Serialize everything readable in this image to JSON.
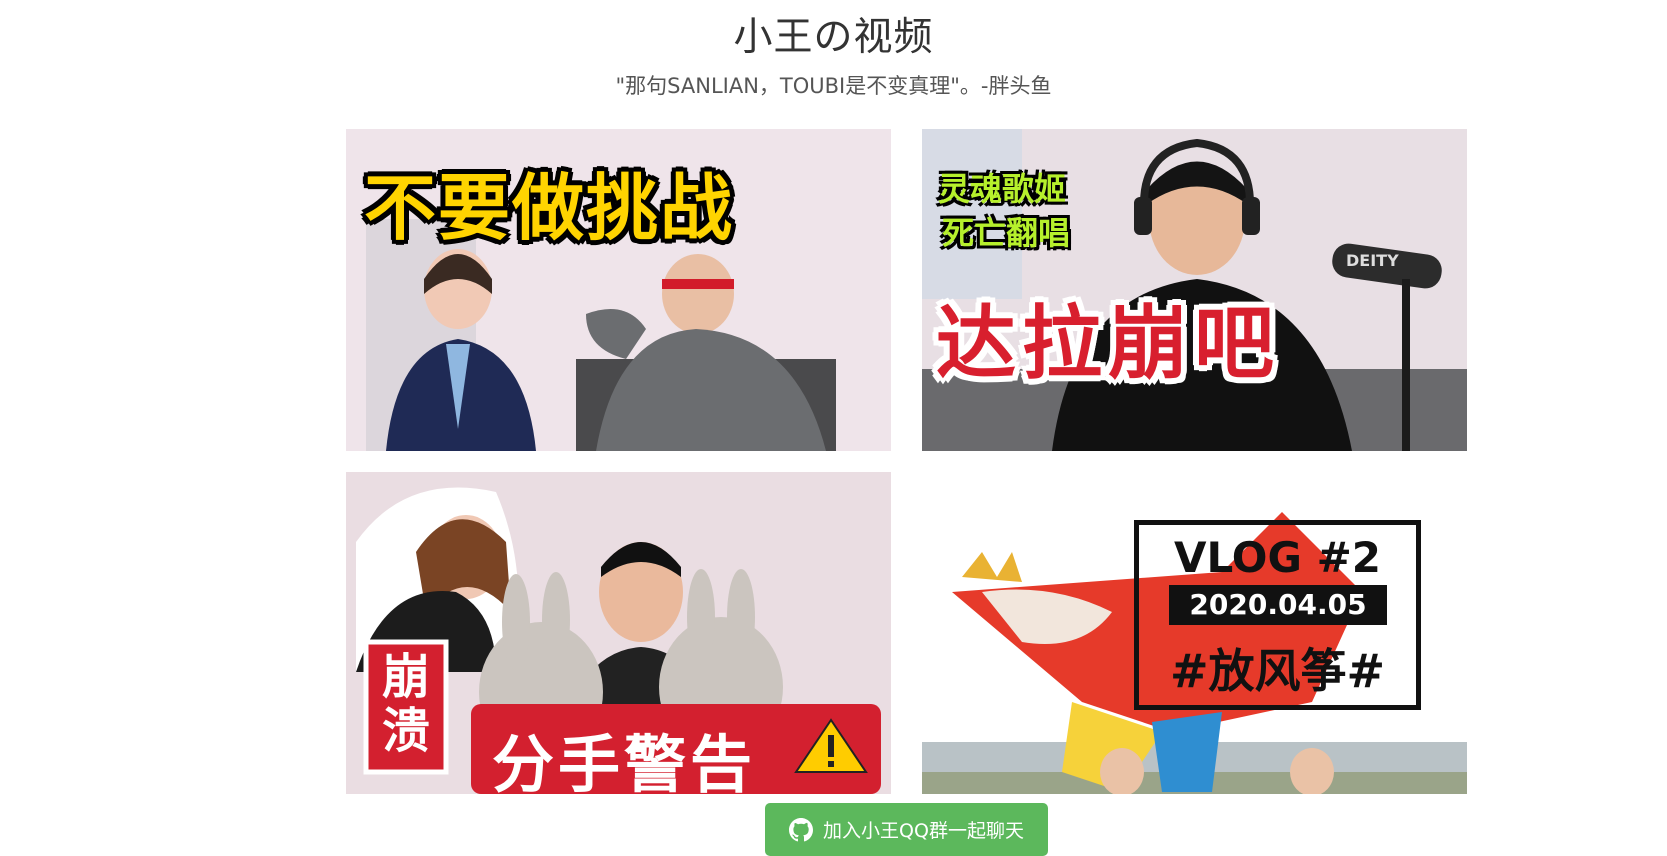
{
  "page": {
    "title": "小王の视频",
    "subtitle": "\"那句SANLIAN，TOUBI是不变真理\"。-胖头鱼"
  },
  "videos": [
    {
      "caption": "不要做挑战"
    },
    {
      "caption_top_line1": "灵魂歌姬",
      "caption_top_line2": "死亡翻唱",
      "caption": "达拉崩吧",
      "mic_label": "DEITY"
    },
    {
      "side_label": "崩溃",
      "caption": "分手警告"
    },
    {
      "vlog_title": "VLOG #2",
      "vlog_date": "2020.04.05",
      "vlog_tag": "#放风筝#"
    }
  ],
  "footer": {
    "qq_button_label": "加入小王QQ群一起聊天",
    "icon": "github-icon"
  },
  "colors": {
    "button_green": "#5cb85c",
    "caption_yellow": "#ffd400",
    "caption_red": "#d81f2e",
    "caption_green": "#b6f02c"
  }
}
